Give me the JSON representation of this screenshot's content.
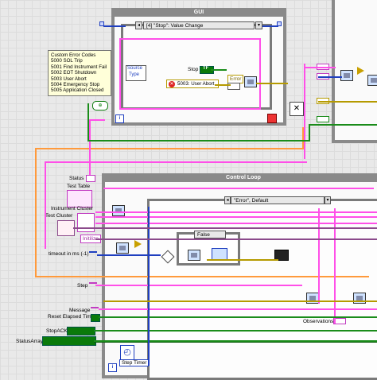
{
  "gui_loop": {
    "title": "GUI",
    "event_selector": "[4] \"Stop\": Value Change",
    "event_items": [
      "Source",
      "Type"
    ],
    "stop_label": "Stop",
    "stop_value": "TF",
    "error_label": "Error",
    "error_constant": "5003: User Abort"
  },
  "custom_error_note": {
    "lines": [
      "Custom Error Codes",
      "5000 SOL Trip",
      "5001 Find Instrument Fail",
      "5002 EOT Shutdown",
      "5003 User Abort",
      "5004 Emergency Stop",
      "5005 Application Closed"
    ]
  },
  "control_loop": {
    "title": "Control Loop",
    "case_selector": "\"Error\", Default",
    "inner_case": "False"
  },
  "left_terminals": {
    "status": "Status",
    "test_table": "Test Table",
    "instrument_cluster": "Instrument Cluster",
    "test_cluster": "Test Cluster",
    "initialize": "Initilize",
    "timeout": "timeout in ms (-1)",
    "step": "Step",
    "message": "Message",
    "reset_elapsed_time": "Reset Elapsed Time",
    "stop_ack": "StopACK",
    "status_array": "StatusArray"
  },
  "observations_label": "Observations",
  "step_timer_label": "Step Timer",
  "colors": {
    "string_wire": "#ff4fe8",
    "cluster_wire": "#ff9a3c",
    "boolean_wire": "#1a8c1a",
    "numeric_wire": "#1f3fbf",
    "error_wire": "#b59a00",
    "structure_border": "#8a8a8a"
  },
  "icons": {
    "iteration_terminal": "i",
    "loop_condition": "stop-sign-icon",
    "timer_icon": "stopwatch-icon"
  }
}
